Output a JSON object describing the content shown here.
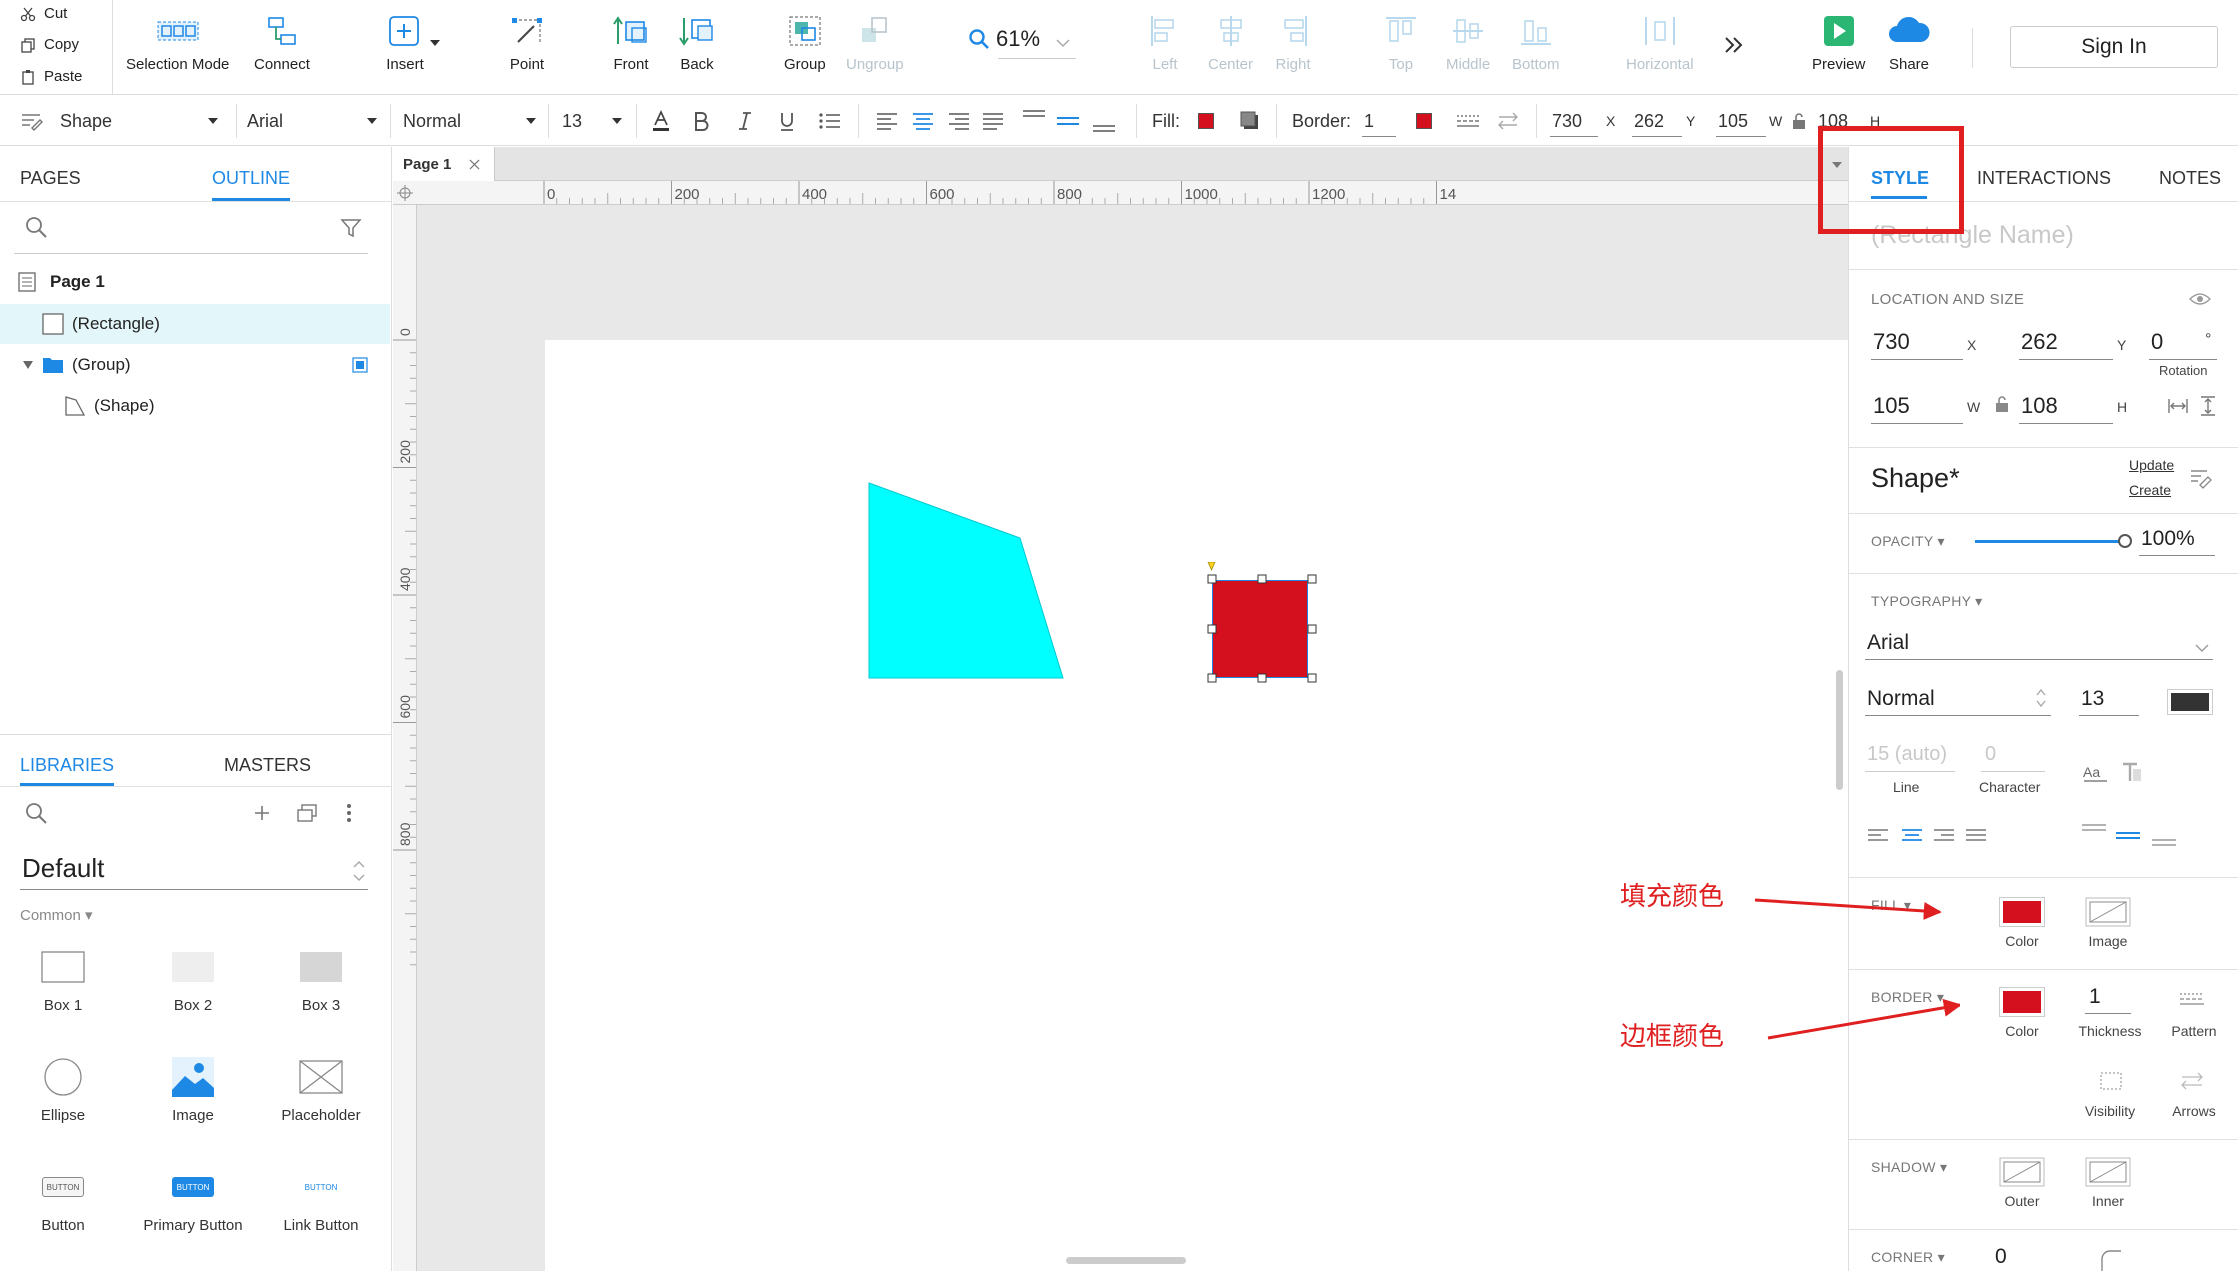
{
  "clipboard": {
    "cut": "Cut",
    "copy": "Copy",
    "paste": "Paste"
  },
  "toolbar": {
    "selection_mode": "Selection Mode",
    "connect": "Connect",
    "insert": "Insert",
    "point": "Point",
    "front": "Front",
    "back": "Back",
    "group": "Group",
    "ungroup": "Ungroup",
    "zoom": "61%",
    "left": "Left",
    "center": "Center",
    "right": "Right",
    "top": "Top",
    "middle": "Middle",
    "bottom": "Bottom",
    "horizontal": "Horizontal",
    "preview": "Preview",
    "share": "Share",
    "sign_in": "Sign In"
  },
  "format_bar": {
    "style": "Shape",
    "font": "Arial",
    "weight": "Normal",
    "size": "13",
    "fill_label": "Fill:",
    "fill_color": "#d40f1e",
    "border_label": "Border:",
    "border_value": "1",
    "border_color": "#d40f1e",
    "x": "730",
    "x_label": "X",
    "y": "262",
    "y_label": "Y",
    "w": "105",
    "w_label": "W",
    "h": "108",
    "h_label": "H"
  },
  "left": {
    "tabs": {
      "pages": "PAGES",
      "outline": "OUTLINE"
    },
    "tree": {
      "page": "Page 1",
      "rectangle": "(Rectangle)",
      "group": "(Group)",
      "shape": "(Shape)"
    },
    "lib_tabs": {
      "libraries": "LIBRARIES",
      "masters": "MASTERS"
    },
    "library_name": "Default",
    "category": "Common ▾",
    "items": [
      "Box 1",
      "Box 2",
      "Box 3",
      "Ellipse",
      "Image",
      "Placeholder",
      "Button",
      "Primary Button",
      "Link Button"
    ],
    "button_thumb": "BUTTON"
  },
  "canvas": {
    "page_tab": "Page 1",
    "ruler_h": [
      "0",
      "200",
      "400",
      "600",
      "800",
      "1000",
      "1200",
      "14"
    ],
    "ruler_v": [
      "0",
      "200",
      "400",
      "600",
      "800"
    ],
    "shape_color": "#00ffff",
    "rect_color": "#d40f1e"
  },
  "right": {
    "tabs": {
      "style": "STYLE",
      "interactions": "INTERACTIONS",
      "notes": "NOTES"
    },
    "name_placeholder": "(Rectangle Name)",
    "location_title": "LOCATION AND SIZE",
    "x": "730",
    "x_label": "X",
    "y": "262",
    "y_label": "Y",
    "rotation": "0",
    "rotation_unit": "°",
    "rotation_label": "Rotation",
    "w": "105",
    "w_label": "W",
    "h": "108",
    "h_label": "H",
    "style_name": "Shape*",
    "update": "Update",
    "create": "Create",
    "opacity_title": "OPACITY ▾",
    "opacity_value": "100%",
    "opacity_fraction": 1.0,
    "typography_title": "TYPOGRAPHY ▾",
    "font": "Arial",
    "weight": "Normal",
    "size": "13",
    "text_color": "#333333",
    "line_value": "15 (auto)",
    "line_label": "Line",
    "char_value": "0",
    "char_label": "Character",
    "fill_title": "FILL ▾",
    "fill_color_label": "Color",
    "fill_image_label": "Image",
    "fill_color": "#d40f1e",
    "border_title": "BORDER ▾",
    "border_color_label": "Color",
    "border_color": "#d40f1e",
    "thickness": "1",
    "thickness_label": "Thickness",
    "pattern_label": "Pattern",
    "visibility_label": "Visibility",
    "arrows_label": "Arrows",
    "shadow_title": "SHADOW ▾",
    "outer_label": "Outer",
    "inner_label": "Inner",
    "corner_title": "CORNER ▾",
    "corner_value": "0"
  },
  "annotations": {
    "fill_note": "填充颜色",
    "border_note": "边框颜色",
    "highlight_color": "#e02020"
  }
}
